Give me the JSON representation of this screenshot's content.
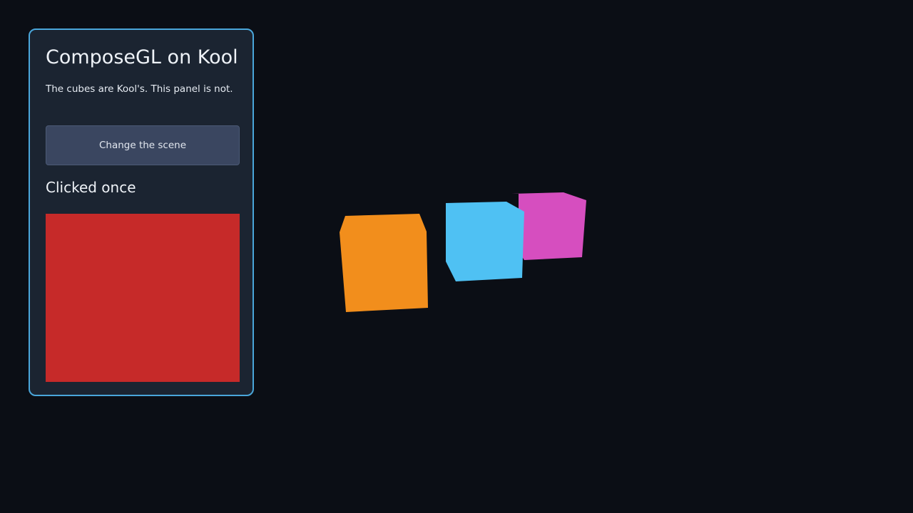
{
  "panel": {
    "title": "ComposeGL on Kool",
    "subtitle": "The cubes are Kool's. This panel is not.",
    "button_label": "Change the scene",
    "status": "Clicked once",
    "swatch_color": "#c62a29"
  },
  "colors": {
    "background": "#0b0e15",
    "panel_bg": "#1b2431",
    "panel_border": "#4aa6da",
    "button_bg": "#3a4660"
  },
  "scene": {
    "cubes": [
      {
        "name": "orange-cube",
        "color": "#f28e1c"
      },
      {
        "name": "blue-cube",
        "color": "#4fc1f3"
      },
      {
        "name": "magenta-cube",
        "color": "#d64ebf"
      }
    ]
  }
}
